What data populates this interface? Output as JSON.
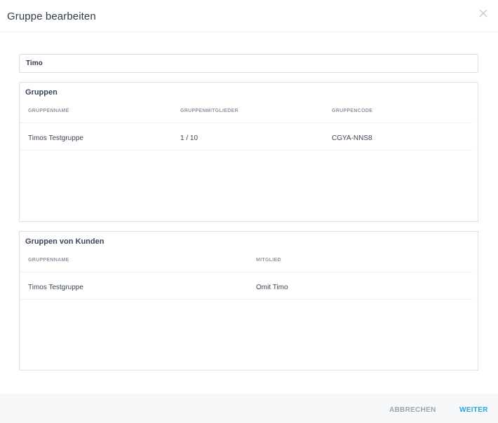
{
  "dialog": {
    "title": "Gruppe bearbeiten",
    "close_icon": "close-icon"
  },
  "name_field": {
    "value": "Timo"
  },
  "groups_panel": {
    "title": "Gruppen",
    "columns": [
      "GRUPPENNAME",
      "GRUPPENMITGLIEDER",
      "GRUPPENCODE"
    ],
    "rows": [
      {
        "name": "Timos Testgruppe",
        "members": "1 / 10",
        "code": "CGYA-NNS8"
      }
    ]
  },
  "customer_groups_panel": {
    "title": "Gruppen von Kunden",
    "columns": [
      "GRUPPENNAME",
      "MITGLIED"
    ],
    "rows": [
      {
        "name": "Timos Testgruppe",
        "member": "Omit Timo"
      }
    ]
  },
  "footer": {
    "cancel_label": "ABBRECHEN",
    "next_label": "WEITER"
  },
  "colors": {
    "accent": "#2aa6df",
    "muted": "#9aa5b0",
    "footer_bg": "#f6f8fa"
  }
}
